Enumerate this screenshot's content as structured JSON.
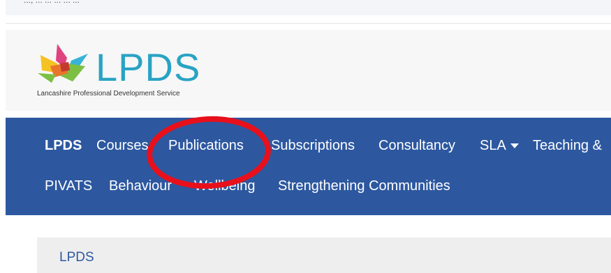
{
  "top_strip": {
    "text": "..., ... ... ... ... ..."
  },
  "header": {
    "logo_text": "LPDS",
    "tagline": "Lancashire Professional Development Service"
  },
  "nav": {
    "brand": "LPDS",
    "row1": [
      "Courses",
      "Publications",
      "Subscriptions",
      "Consultancy",
      "SLA",
      "Teaching &"
    ],
    "row2": [
      "PIVATS",
      "Behaviour",
      "Wellbeing",
      "Strengthening Communities"
    ]
  },
  "breadcrumb": {
    "current": "LPDS"
  },
  "colors": {
    "navbar": "#2d58a0",
    "logo_text": "#29a3c4",
    "annotation": "#e8101b"
  }
}
